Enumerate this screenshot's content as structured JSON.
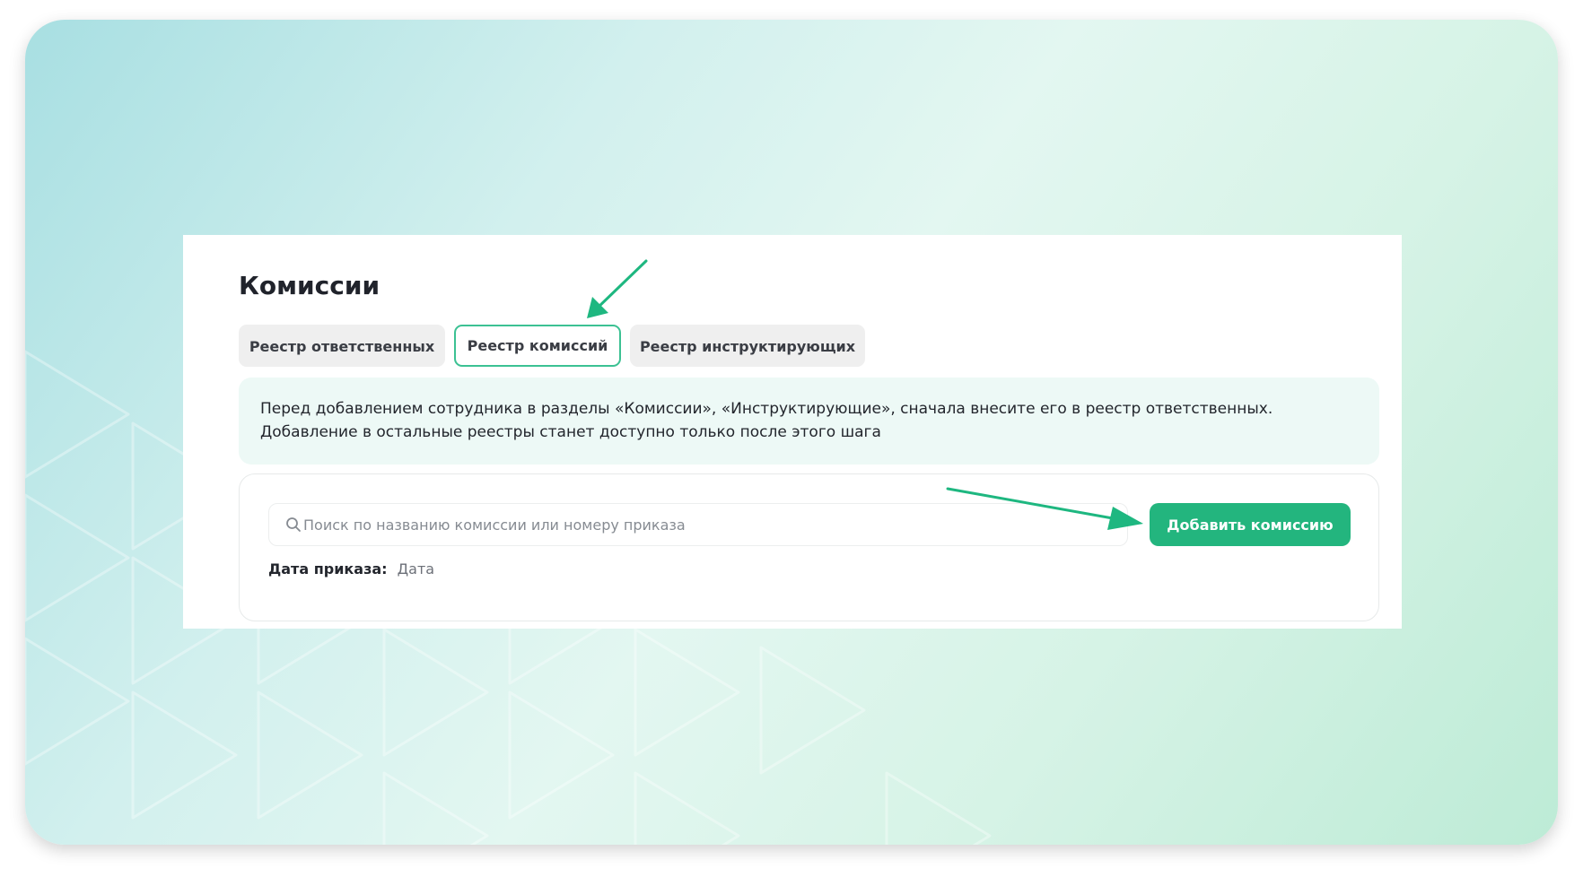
{
  "page": {
    "title": "Комиссии"
  },
  "tabs": [
    {
      "label": "Реестр ответственных",
      "active": false
    },
    {
      "label": "Реестр комиссий",
      "active": true
    },
    {
      "label": "Реестр инструктирующих",
      "active": false
    }
  ],
  "notice": {
    "line1": "Перед добавлением сотрудника в разделы «Комиссии», «Инструктирующие», сначала внесите его в реестр ответственных.",
    "line2": "Добавление в остальные реестры станет доступно только после этого шага"
  },
  "search": {
    "placeholder": "Поиск по названию комиссии или номеру приказа",
    "value": ""
  },
  "add_button": {
    "label": "Добавить комиссию"
  },
  "filter": {
    "date_label": "Дата приказа:",
    "date_value": "Дата"
  },
  "colors": {
    "accent": "#23b57e",
    "active_tab_border": "#3cc193",
    "notice_bg": "#edf9f6",
    "annotation_arrow": "#1eb780"
  },
  "icons": {
    "search": "search-icon",
    "annotation": "arrow-annotation-icon"
  }
}
